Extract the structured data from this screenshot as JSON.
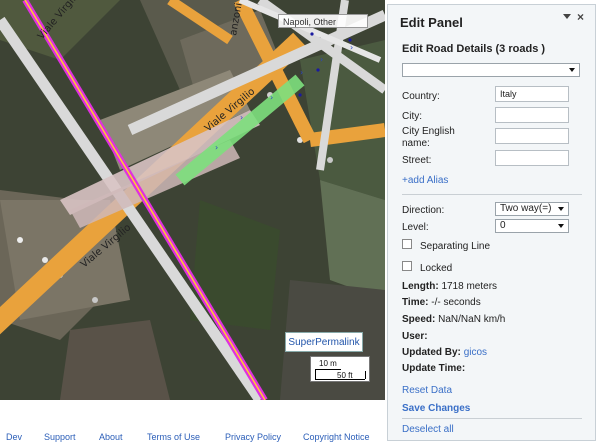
{
  "map": {
    "area_label": "Napoli, Other",
    "street_labels": [
      "Viale Virgilio",
      "Viale Virgilio",
      "Viale Virgilio",
      "anzoni"
    ],
    "permalink_label": "SuperPermalink",
    "scale": {
      "metric": "10 m",
      "imperial": "50 ft"
    }
  },
  "panel": {
    "title": "Edit Panel",
    "subtitle": "Edit Road Details (3 roads )",
    "road_select_value": "",
    "fields": {
      "country_label": "Country:",
      "country_value": "Italy",
      "city_label": "City:",
      "city_value": "",
      "city_english_label": "City English name:",
      "city_english_value": "",
      "street_label": "Street:",
      "street_value": ""
    },
    "add_alias": "+add Alias",
    "direction_label": "Direction:",
    "direction_value": "Two way(=)",
    "level_label": "Level:",
    "level_value": "0",
    "separating_line_label": "Separating Line",
    "locked_label": "Locked",
    "info": {
      "length_label": "Length:",
      "length_value": "1718 meters",
      "time_label": "Time:",
      "time_value": "-/- seconds",
      "speed_label": "Speed:",
      "speed_value": "NaN/NaN km/h",
      "user_label": "User:",
      "updated_by_label": "Updated By:",
      "updated_by_value": "gicos",
      "update_time_label": "Update Time:"
    },
    "reset_data": "Reset Data",
    "save_changes": "Save Changes",
    "deselect_all": "Deselect all"
  },
  "footer": {
    "links": [
      "Dev",
      "Support",
      "About",
      "Terms of Use",
      "Privacy Policy",
      "Copyright Notice"
    ]
  }
}
